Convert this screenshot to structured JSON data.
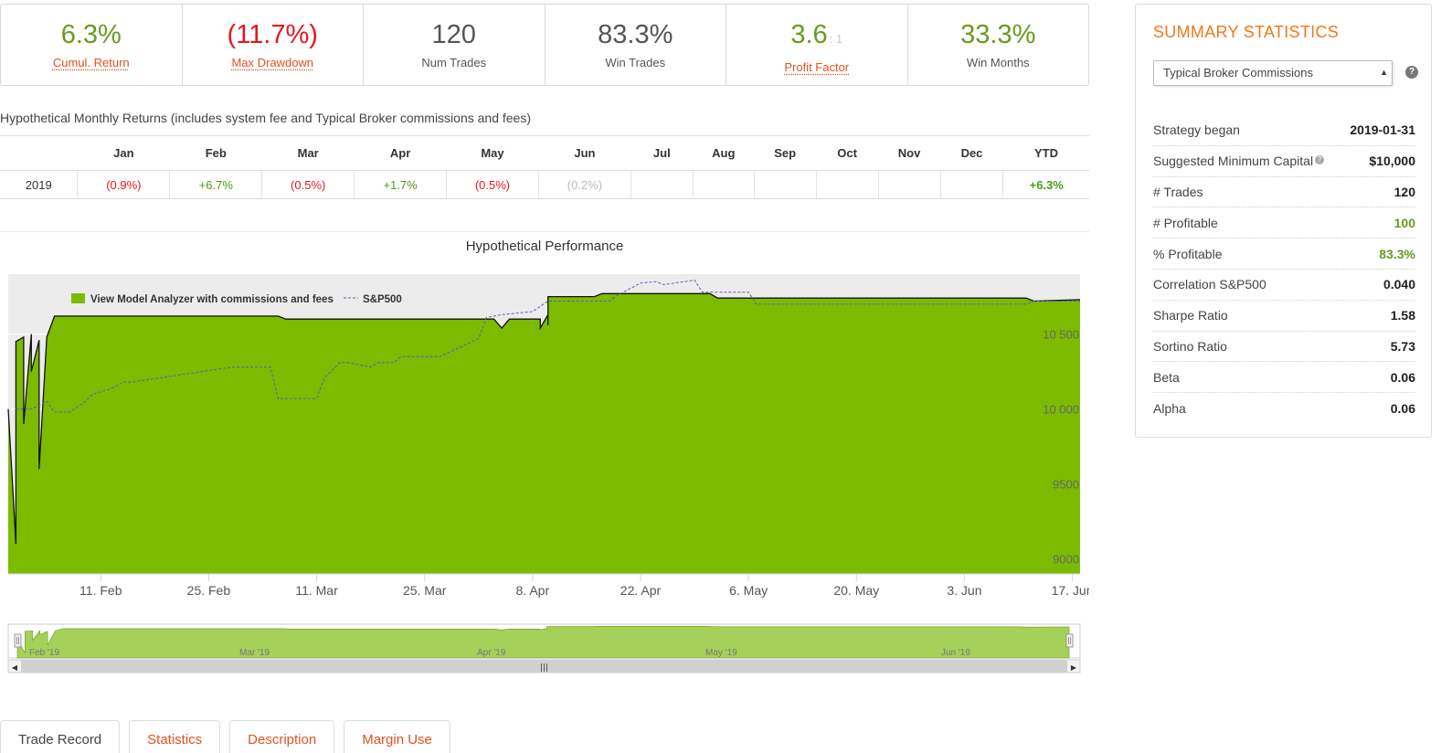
{
  "kpis": [
    {
      "value": "6.3%",
      "sub": "",
      "label": "Cumul. Return",
      "color": "green",
      "link": true
    },
    {
      "value": "(11.7%)",
      "sub": "",
      "label": "Max Drawdown",
      "color": "red",
      "link": true
    },
    {
      "value": "120",
      "sub": "",
      "label": "Num Trades",
      "color": "dark",
      "link": false
    },
    {
      "value": "83.3%",
      "sub": "",
      "label": "Win Trades",
      "color": "dark",
      "link": false
    },
    {
      "value": "3.6",
      "sub": ": 1",
      "label": "Profit Factor",
      "color": "green",
      "link": true
    },
    {
      "value": "33.3%",
      "sub": "",
      "label": "Win Months",
      "color": "green",
      "link": false
    }
  ],
  "monthly": {
    "title": "Hypothetical Monthly Returns (includes system fee and Typical Broker commissions and fees)",
    "headers": [
      "",
      "Jan",
      "Feb",
      "Mar",
      "Apr",
      "May",
      "Jun",
      "Jul",
      "Aug",
      "Sep",
      "Oct",
      "Nov",
      "Dec",
      "YTD"
    ],
    "rows": [
      {
        "year": "2019",
        "cells": [
          {
            "v": "(0.9%)",
            "c": "neg"
          },
          {
            "v": "+6.7%",
            "c": "pos"
          },
          {
            "v": "(0.5%)",
            "c": "neg"
          },
          {
            "v": "+1.7%",
            "c": "pos"
          },
          {
            "v": "(0.5%)",
            "c": "neg"
          },
          {
            "v": "(0.2%)",
            "c": "muted"
          },
          {
            "v": "",
            "c": ""
          },
          {
            "v": "",
            "c": ""
          },
          {
            "v": "",
            "c": ""
          },
          {
            "v": "",
            "c": ""
          },
          {
            "v": "",
            "c": ""
          },
          {
            "v": "",
            "c": ""
          },
          {
            "v": "+6.3%",
            "c": "ytd"
          }
        ]
      }
    ]
  },
  "chart_title": "Hypothetical Performance",
  "chart_data": {
    "type": "area",
    "title": "Hypothetical Performance",
    "xlabel": "",
    "ylabel": "",
    "x_range": [
      "2019-01-30",
      "2019-06-18"
    ],
    "ylim": [
      8900,
      10900
    ],
    "y_ticks": [
      9000,
      9500,
      10000,
      10500
    ],
    "y_tick_labels": [
      "9000",
      "9500",
      "10 000",
      "10 500"
    ],
    "x_ticks": [
      "2019-02-11",
      "2019-02-25",
      "2019-03-11",
      "2019-03-25",
      "2019-04-08",
      "2019-04-22",
      "2019-05-06",
      "2019-05-20",
      "2019-06-03",
      "2019-06-17"
    ],
    "x_tick_labels": [
      "11. Feb",
      "25. Feb",
      "11. Mar",
      "25. Mar",
      "8. Apr",
      "22. Apr",
      "6. May",
      "20. May",
      "3. Jun",
      "17. Jun"
    ],
    "legend_position": "top-left",
    "series": [
      {
        "name": "View Model Analyzer with commissions and fees",
        "style": "area",
        "color": "#7cbb00",
        "x": [
          "2019-01-30",
          "2019-01-31",
          "2019-01-31",
          "2019-02-01",
          "2019-02-01",
          "2019-02-02",
          "2019-02-02",
          "2019-02-03",
          "2019-02-03",
          "2019-02-04",
          "2019-02-05",
          "2019-03-06",
          "2019-03-07",
          "2019-04-03",
          "2019-04-04",
          "2019-04-05",
          "2019-04-09",
          "2019-04-09",
          "2019-04-10",
          "2019-04-10",
          "2019-04-10",
          "2019-04-16",
          "2019-04-17",
          "2019-05-01",
          "2019-05-02",
          "2019-06-11",
          "2019-06-12",
          "2019-06-18"
        ],
        "y": [
          10000,
          9100,
          10450,
          10480,
          9900,
          10500,
          10250,
          10460,
          9600,
          10480,
          10620,
          10620,
          10600,
          10600,
          10540,
          10600,
          10600,
          10540,
          10630,
          10560,
          10750,
          10750,
          10770,
          10770,
          10740,
          10740,
          10720,
          10730
        ]
      },
      {
        "name": "S&P500",
        "style": "dashed",
        "color": "#5b5bc0",
        "x": [
          "2019-01-31",
          "2019-02-02",
          "2019-02-04",
          "2019-02-05",
          "2019-02-06",
          "2019-02-07",
          "2019-02-09",
          "2019-02-10",
          "2019-02-12",
          "2019-02-14",
          "2019-02-15",
          "2019-02-28",
          "2019-03-01",
          "2019-03-05",
          "2019-03-06",
          "2019-03-07",
          "2019-03-09",
          "2019-03-11",
          "2019-03-12",
          "2019-03-14",
          "2019-03-15",
          "2019-03-18",
          "2019-03-19",
          "2019-03-21",
          "2019-03-22",
          "2019-03-27",
          "2019-04-01",
          "2019-04-02",
          "2019-04-04",
          "2019-04-08",
          "2019-04-10",
          "2019-04-18",
          "2019-04-19",
          "2019-04-22",
          "2019-04-24",
          "2019-04-25",
          "2019-04-29",
          "2019-04-30",
          "2019-05-02",
          "2019-05-06",
          "2019-05-07",
          "2019-06-11",
          "2019-06-12",
          "2019-06-18"
        ],
        "y": [
          10000,
          10000,
          10050,
          9980,
          9980,
          9980,
          10050,
          10100,
          10130,
          10180,
          10180,
          10280,
          10280,
          10280,
          10070,
          10070,
          10070,
          10070,
          10210,
          10310,
          10310,
          10280,
          10310,
          10310,
          10350,
          10350,
          10470,
          10610,
          10630,
          10650,
          10720,
          10720,
          10760,
          10840,
          10850,
          10830,
          10860,
          10780,
          10780,
          10780,
          10700,
          10700,
          10720,
          10720
        ]
      }
    ]
  },
  "navigator": {
    "labels": [
      "Feb '19",
      "Mar '19",
      "Apr '19",
      "May '19",
      "Jun '19"
    ],
    "fill_color": "#a5d05a"
  },
  "tabs": [
    "Trade Record",
    "Statistics",
    "Description",
    "Margin Use"
  ],
  "summary": {
    "title": "SUMMARY STATISTICS",
    "select_value": "Typical Broker Commissions",
    "help_glyph": "?",
    "rows": [
      {
        "k": "Strategy began",
        "v": "2019-01-31",
        "c": "",
        "info": false
      },
      {
        "k": "Suggested Minimum Capital",
        "v": "$10,000",
        "c": "",
        "info": true
      },
      {
        "k": "# Trades",
        "v": "120",
        "c": "",
        "info": false
      },
      {
        "k": "# Profitable",
        "v": "100",
        "c": "green",
        "info": false
      },
      {
        "k": "% Profitable",
        "v": "83.3%",
        "c": "green",
        "info": false
      },
      {
        "k": "Correlation S&P500",
        "v": "0.040",
        "c": "",
        "info": false
      },
      {
        "k": "Sharpe Ratio",
        "v": "1.58",
        "c": "",
        "info": false
      },
      {
        "k": "Sortino Ratio",
        "v": "5.73",
        "c": "",
        "info": false
      },
      {
        "k": "Beta",
        "v": "0.06",
        "c": "",
        "info": false
      },
      {
        "k": "Alpha",
        "v": "0.06",
        "c": "",
        "info": false
      }
    ]
  }
}
